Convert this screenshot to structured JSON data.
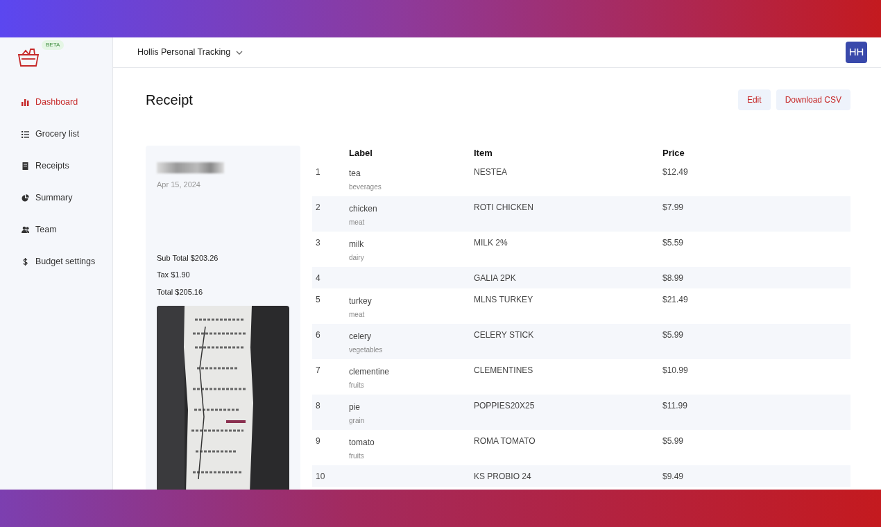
{
  "sidebar": {
    "badge": "BETA",
    "items": [
      {
        "label": "Dashboard",
        "selected": true
      },
      {
        "label": "Grocery list",
        "selected": false
      },
      {
        "label": "Receipts",
        "selected": false
      },
      {
        "label": "Summary",
        "selected": false
      },
      {
        "label": "Team",
        "selected": false
      },
      {
        "label": "Budget settings",
        "selected": false
      }
    ]
  },
  "topbar": {
    "workspace": "Hollis Personal Tracking",
    "avatar": "HH"
  },
  "page": {
    "title": "Receipt",
    "buttons": [
      "Edit",
      "Download CSV"
    ]
  },
  "receipt": {
    "date": "Apr 15, 2024",
    "totals": [
      "Sub Total $203.26",
      "Tax $1.90",
      "Total $205.16"
    ]
  },
  "table": {
    "columns": [
      "Label",
      "Item",
      "Price"
    ],
    "rows": [
      {
        "number": "1",
        "label": "tea",
        "category": "beverages",
        "item": "NESTEA",
        "price": "$12.49"
      },
      {
        "number": "2",
        "label": "chicken",
        "category": "meat",
        "item": "ROTI CHICKEN",
        "price": "$7.99"
      },
      {
        "number": "3",
        "label": "milk",
        "category": "dairy",
        "item": "MILK 2%",
        "price": "$5.59"
      },
      {
        "number": "4",
        "item": "GALIA 2PK",
        "price": "$8.99"
      },
      {
        "number": "5",
        "label": "turkey",
        "category": "meat",
        "item": "MLNS TURKEY",
        "price": "$21.49"
      },
      {
        "number": "6",
        "label": "celery",
        "category": "vegetables",
        "item": "CELERY STICK",
        "price": "$5.99"
      },
      {
        "number": "7",
        "label": "clementine",
        "category": "fruits",
        "item": "CLEMENTINES",
        "price": "$10.99"
      },
      {
        "number": "8",
        "label": "pie",
        "category": "grain",
        "item": "POPPIES20X25",
        "price": "$11.99"
      },
      {
        "number": "9",
        "label": "tomato",
        "category": "fruits",
        "item": "ROMA TOMATO",
        "price": "$5.99"
      },
      {
        "number": "10",
        "item": "KS PROBIO 24",
        "price": "$9.49"
      }
    ]
  }
}
